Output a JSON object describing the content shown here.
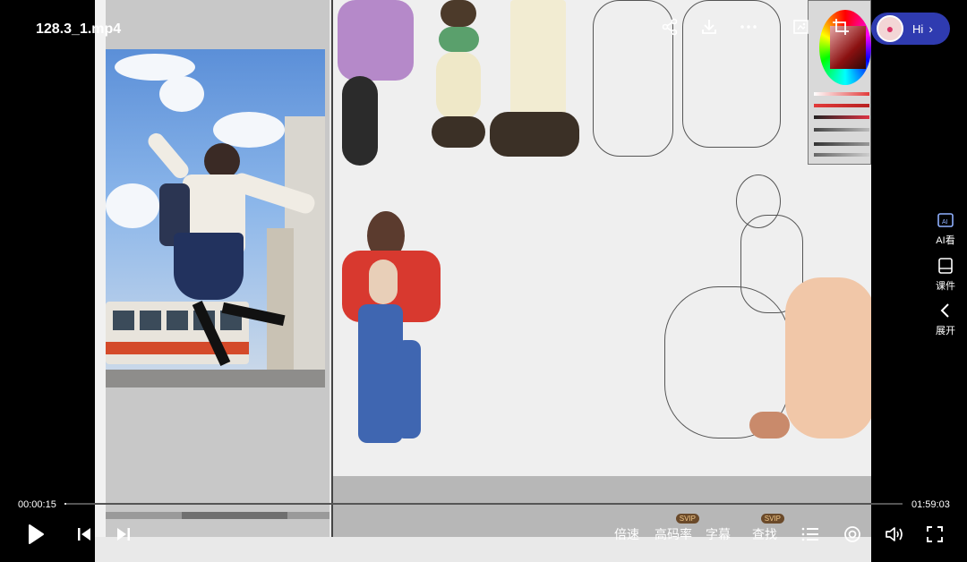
{
  "video": {
    "title": "128.3_1.mp4"
  },
  "top_actions": [
    {
      "name": "share-icon"
    },
    {
      "name": "download-icon"
    },
    {
      "name": "more-icon"
    },
    {
      "name": "screenshot-icon"
    },
    {
      "name": "crop-icon"
    }
  ],
  "assistant": {
    "label": "Hi"
  },
  "side_panel": {
    "ai_label": "AI看",
    "courseware_label": "课件",
    "expand_label": "展开"
  },
  "playback": {
    "current_time": "00:00:15",
    "total_time": "01:59:03",
    "progress": 0.002
  },
  "controls": {
    "speed_label": "倍速",
    "quality_label": "高码率",
    "quality_badge": "SVIP",
    "subtitle_label": "字幕",
    "search_label": "查找",
    "search_badge": "SVIP"
  },
  "colors": {
    "accent": "#2f3bb0",
    "badge_bg": "#6b4a2a",
    "badge_text": "#f2c98a"
  }
}
